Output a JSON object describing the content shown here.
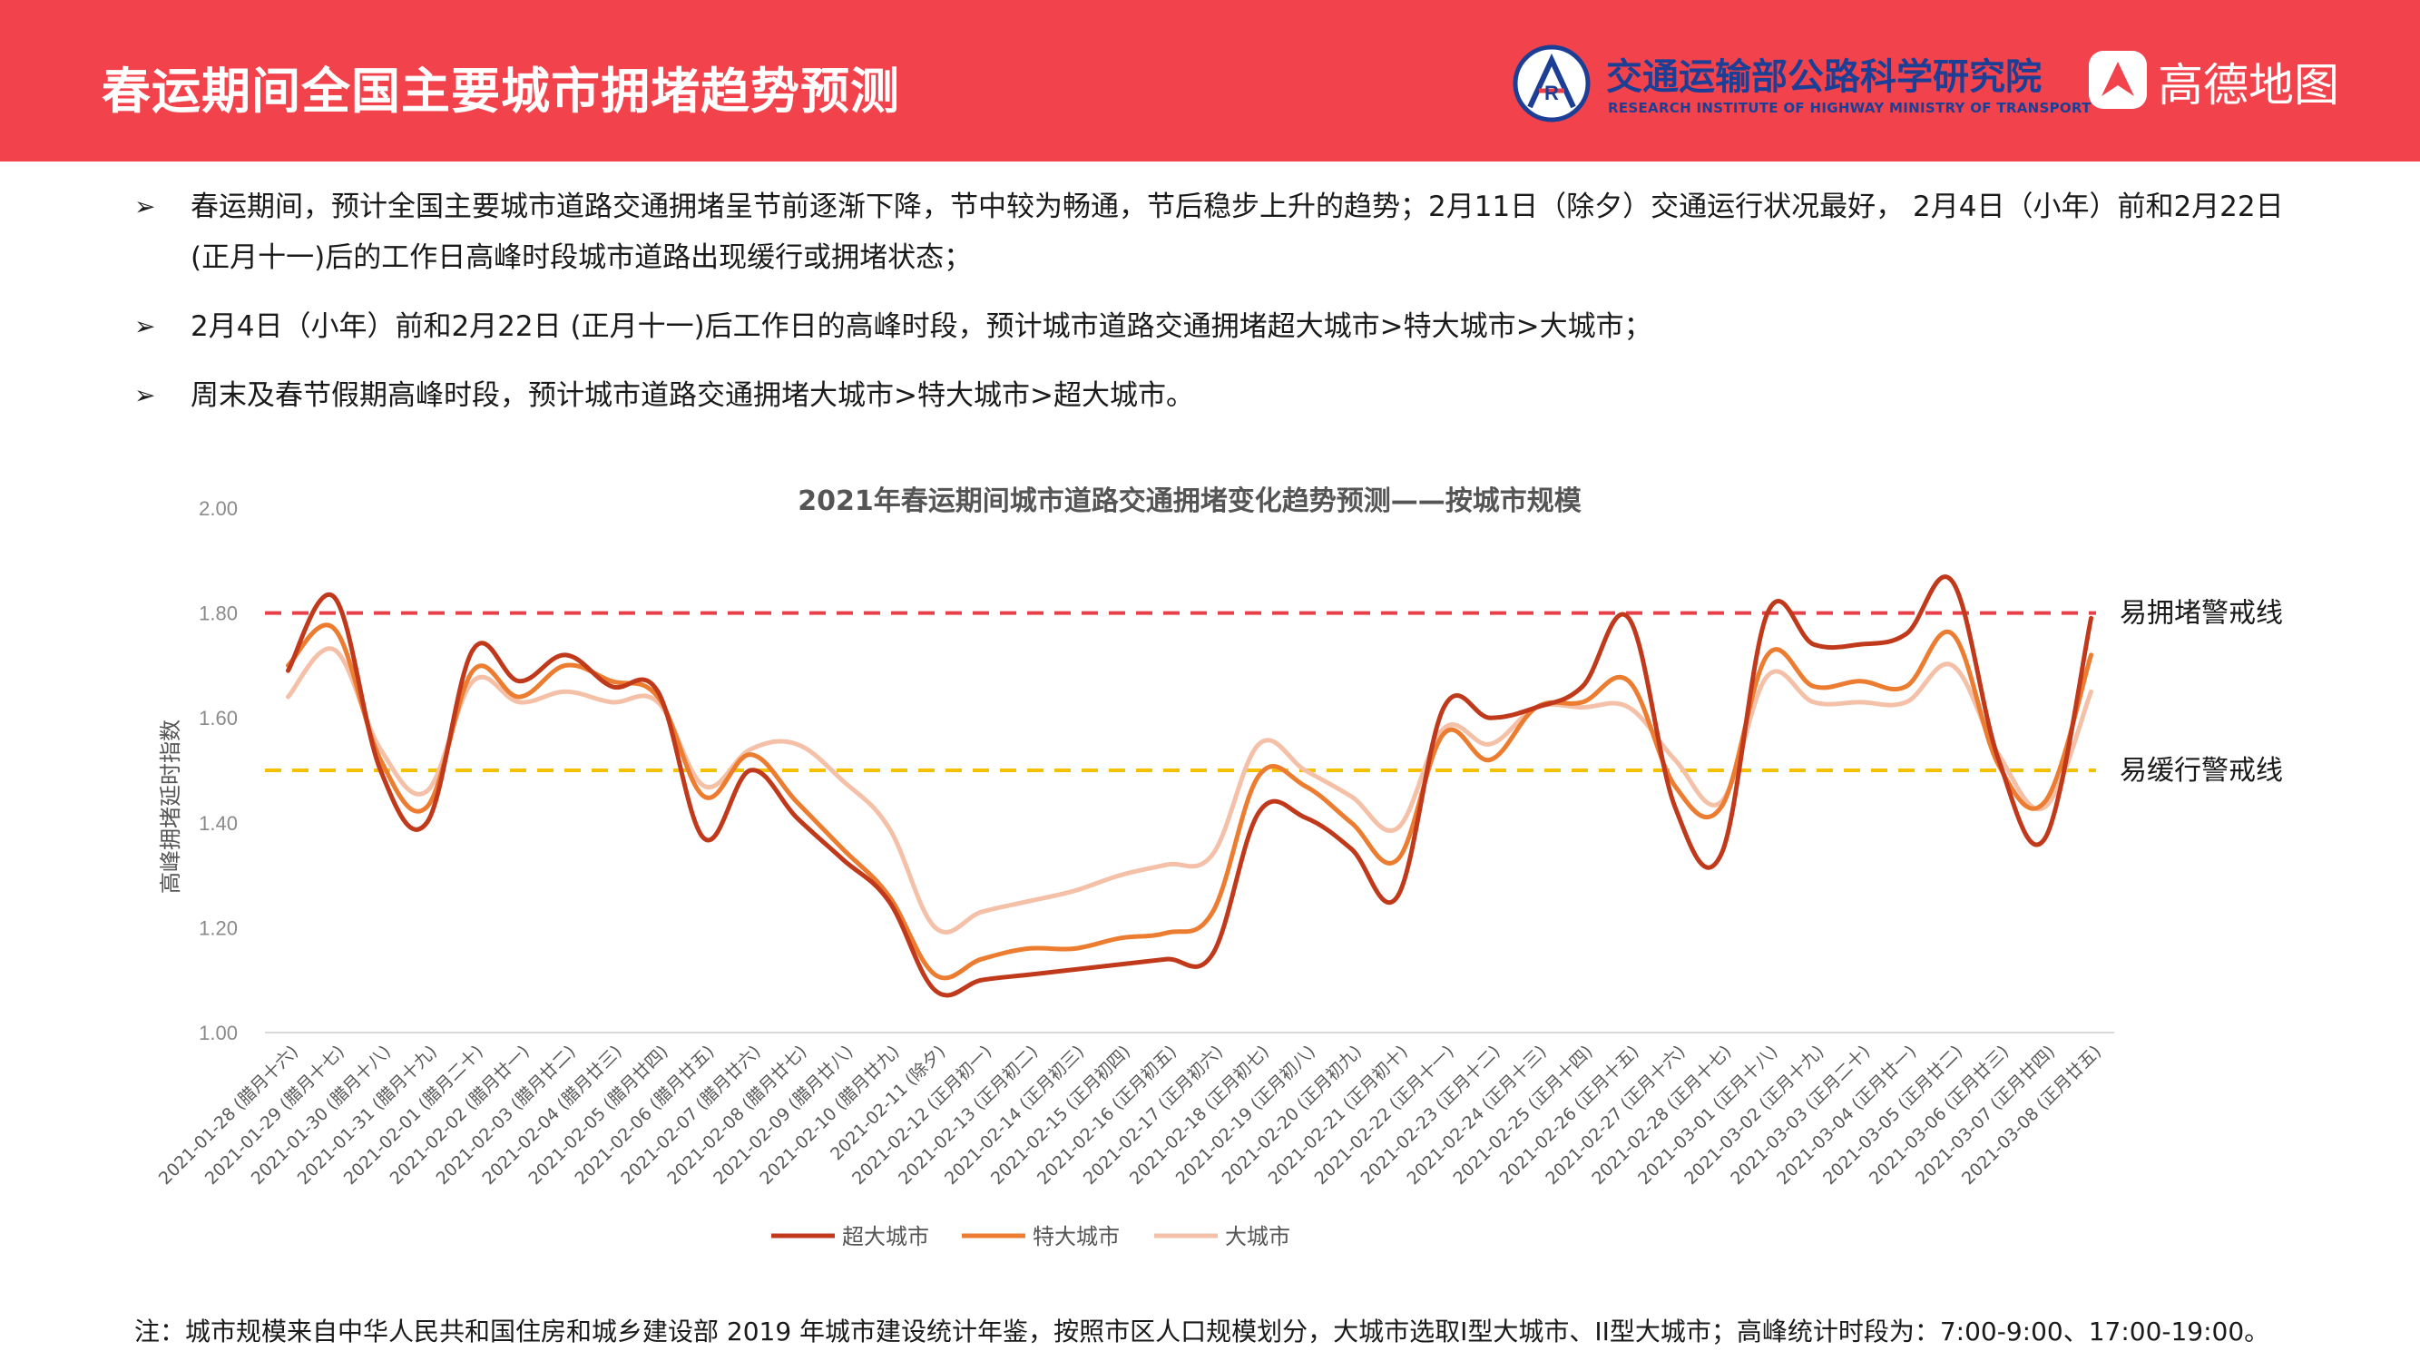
{
  "header": {
    "title": "春运期间全国主要城市拥堵趋势预测",
    "org_cn": "交通运输部公路科学研究院",
    "org_en": "RESEARCH INSTITUTE OF HIGHWAY MINISTRY OF TRANSPORT",
    "brand": "高德地图"
  },
  "bullets": [
    {
      "marker": "➢",
      "text": "春运期间，预计全国主要城市道路交通拥堵呈节前逐渐下降，节中较为畅通，节后稳步上升的趋势；2月11日（除夕）交通运行状况最好， 2月4日（小年）前和2月22日 (正月十一)后的工作日高峰时段城市道路出现缓行或拥堵状态；"
    },
    {
      "marker": "➢",
      "text": "2月4日（小年）前和2月22日 (正月十一)后工作日的高峰时段，预计城市道路交通拥堵超大城市>特大城市>大城市；"
    },
    {
      "marker": "➢",
      "text": "周末及春节假期高峰时段，预计城市道路交通拥堵大城市>特大城市>超大城市。"
    }
  ],
  "footnote": "注：城市规模来自中华人民共和国住房和城乡建设部 2019 年城市建设统计年鉴，按照市区人口规模划分，大城市选取I型大城市、II型大城市；高峰统计时段为：7:00-9:00、17:00-19:00。",
  "chart_data": {
    "type": "line",
    "title": "2021年春运期间城市道路交通拥堵变化趋势预测——按城市规模",
    "xlabel": "",
    "ylabel": "高峰拥堵延时指数",
    "ylim": [
      1.0,
      2.0
    ],
    "yticks": [
      "1.00",
      "1.20",
      "1.40",
      "1.60",
      "1.80",
      "2.00"
    ],
    "grid": false,
    "legend_position": "bottom",
    "categories": [
      "2021-01-28 (腊月十六)",
      "2021-01-29 (腊月十七)",
      "2021-01-30 (腊月十八)",
      "2021-01-31 (腊月十九)",
      "2021-02-01 (腊月二十)",
      "2021-02-02 (腊月廿一)",
      "2021-02-03 (腊月廿二)",
      "2021-02-04 (腊月廿三)",
      "2021-02-05 (腊月廿四)",
      "2021-02-06 (腊月廿五)",
      "2021-02-07 (腊月廿六)",
      "2021-02-08 (腊月廿七)",
      "2021-02-09 (腊月廿八)",
      "2021-02-10 (腊月廿九)",
      "2021-02-11 (除夕)",
      "2021-02-12 (正月初一)",
      "2021-02-13 (正月初二)",
      "2021-02-14 (正月初三)",
      "2021-02-15 (正月初四)",
      "2021-02-16 (正月初五)",
      "2021-02-17 (正月初六)",
      "2021-02-18 (正月初七)",
      "2021-02-19 (正月初八)",
      "2021-02-20 (正月初九)",
      "2021-02-21 (正月初十)",
      "2021-02-22 (正月十一)",
      "2021-02-23 (正月十二)",
      "2021-02-24 (正月十三)",
      "2021-02-25 (正月十四)",
      "2021-02-26 (正月十五)",
      "2021-02-27 (正月十六)",
      "2021-02-28 (正月十七)",
      "2021-03-01 (正月十八)",
      "2021-03-02 (正月十九)",
      "2021-03-03 (正月二十)",
      "2021-03-04 (正月廿一)",
      "2021-03-05 (正月廿二)",
      "2021-03-06 (正月廿三)",
      "2021-03-07 (正月廿四)",
      "2021-03-08 (正月廿五)"
    ],
    "series": [
      {
        "name": "超大城市",
        "color": "#c0391b",
        "values": [
          1.69,
          1.83,
          1.5,
          1.4,
          1.73,
          1.67,
          1.72,
          1.66,
          1.65,
          1.37,
          1.5,
          1.41,
          1.33,
          1.25,
          1.08,
          1.1,
          1.11,
          1.12,
          1.13,
          1.14,
          1.15,
          1.42,
          1.41,
          1.35,
          1.26,
          1.62,
          1.6,
          1.62,
          1.66,
          1.79,
          1.43,
          1.34,
          1.8,
          1.74,
          1.74,
          1.76,
          1.86,
          1.52,
          1.37,
          1.79
        ]
      },
      {
        "name": "特大城市",
        "color": "#ec7c30",
        "values": [
          1.7,
          1.77,
          1.52,
          1.43,
          1.69,
          1.64,
          1.7,
          1.67,
          1.64,
          1.45,
          1.53,
          1.44,
          1.35,
          1.26,
          1.11,
          1.14,
          1.16,
          1.16,
          1.18,
          1.19,
          1.23,
          1.49,
          1.47,
          1.4,
          1.33,
          1.57,
          1.52,
          1.62,
          1.63,
          1.67,
          1.47,
          1.43,
          1.72,
          1.66,
          1.67,
          1.66,
          1.76,
          1.51,
          1.44,
          1.72
        ]
      },
      {
        "name": "大城市",
        "color": "#f5c0a8",
        "values": [
          1.64,
          1.73,
          1.54,
          1.46,
          1.67,
          1.63,
          1.65,
          1.63,
          1.63,
          1.47,
          1.54,
          1.55,
          1.48,
          1.39,
          1.2,
          1.23,
          1.25,
          1.27,
          1.3,
          1.32,
          1.34,
          1.55,
          1.5,
          1.45,
          1.39,
          1.58,
          1.55,
          1.62,
          1.62,
          1.62,
          1.52,
          1.44,
          1.68,
          1.63,
          1.63,
          1.63,
          1.7,
          1.53,
          1.43,
          1.65
        ]
      }
    ],
    "reference_lines": [
      {
        "label": "易拥堵警戒线",
        "y": 1.8,
        "color": "#e8404a",
        "style": "dashed"
      },
      {
        "label": "易缓行警戒线",
        "y": 1.5,
        "color": "#f5c000",
        "style": "dashed"
      }
    ]
  }
}
